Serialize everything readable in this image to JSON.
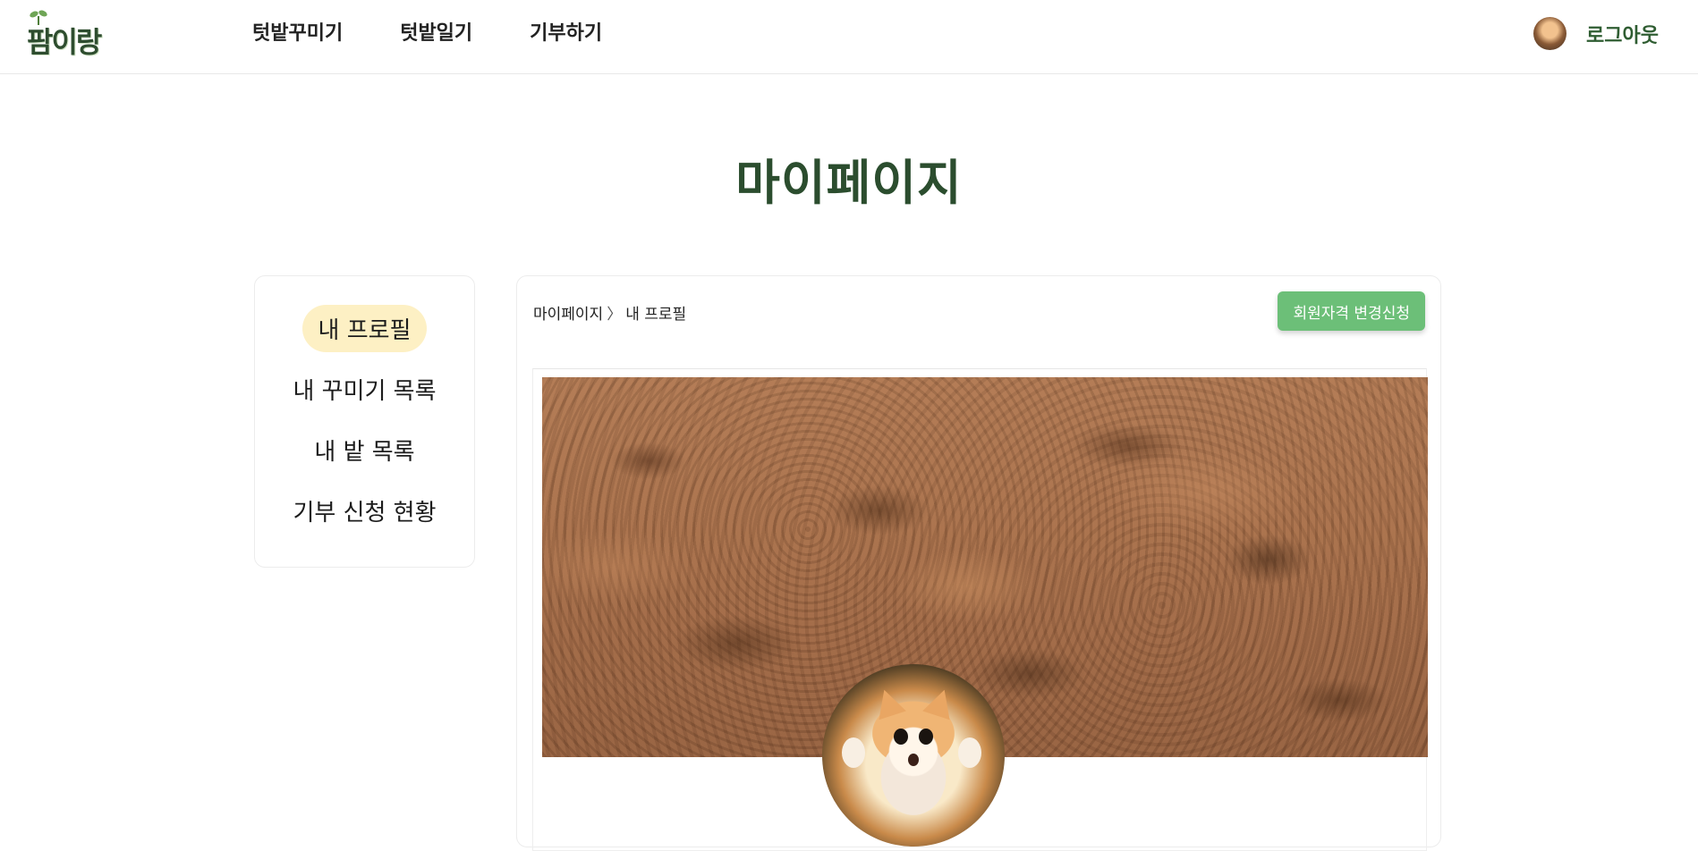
{
  "header": {
    "logo_text": "팜이랑",
    "nav": [
      "텃밭꾸미기",
      "텃밭일기",
      "기부하기"
    ],
    "logout_label": "로그아웃"
  },
  "page": {
    "title": "마이페이지"
  },
  "sidebar": {
    "items": [
      {
        "label": "내 프로필",
        "active": true
      },
      {
        "label": "내 꾸미기 목록",
        "active": false
      },
      {
        "label": "내 밭 목록",
        "active": false
      },
      {
        "label": "기부 신청 현황",
        "active": false
      }
    ]
  },
  "main": {
    "breadcrumb": {
      "root": "마이페이지",
      "separator": "〉",
      "current": "내 프로필"
    },
    "apply_button_label": "회원자격 변경신청"
  },
  "colors": {
    "brand_dark_green": "#2b4d2e",
    "button_green": "#6cbf78",
    "active_pill": "#fdf0c4"
  },
  "icons": {
    "logo": "sprout-logo-icon",
    "user_avatar": "user-avatar-icon",
    "profile_image": "cat-profile-image",
    "banner_image": "soil-banner-image"
  }
}
